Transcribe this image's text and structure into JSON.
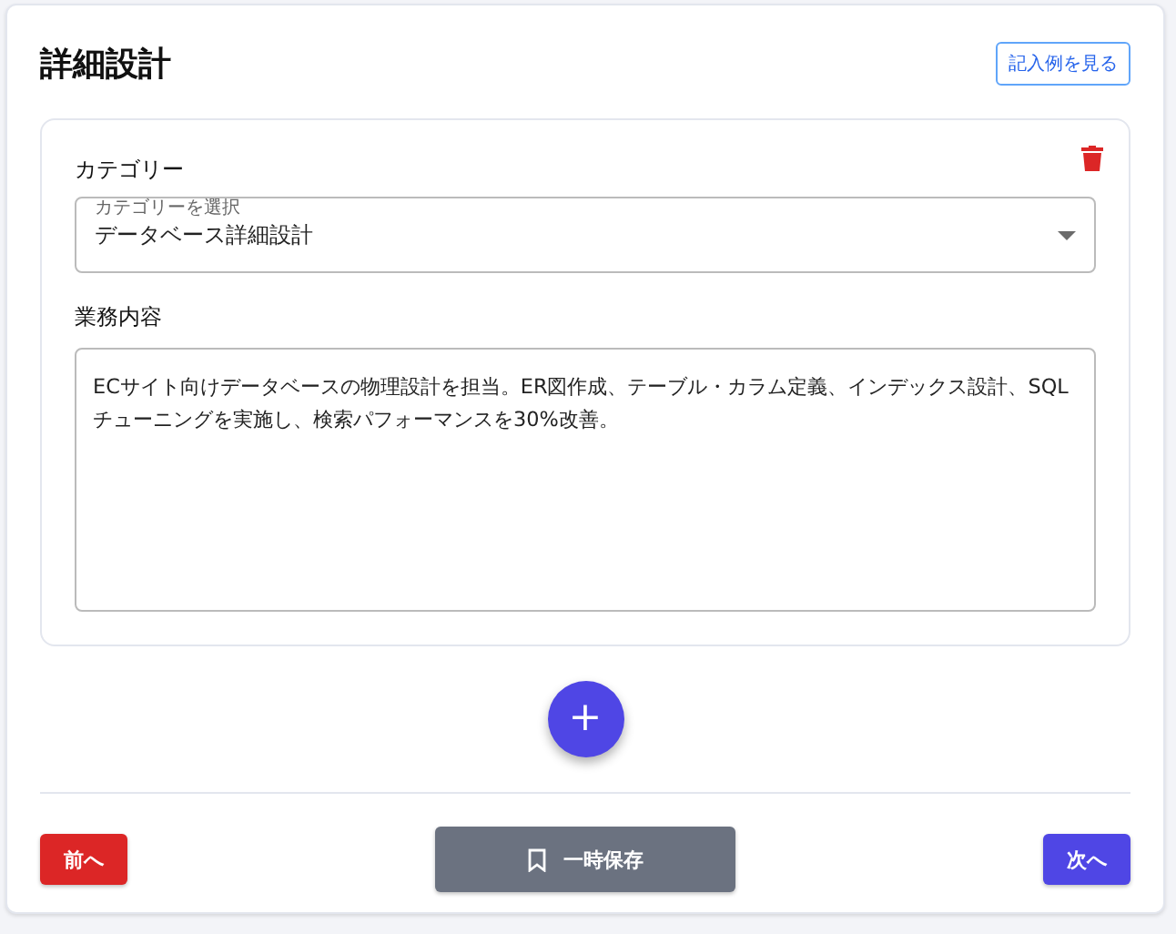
{
  "title": "詳細設計",
  "example_button": "記入例を見る",
  "entry": {
    "category_label": "カテゴリー",
    "select": {
      "label": "カテゴリーを選択",
      "value": "データベース詳細設計"
    },
    "content_label": "業務内容",
    "content": "ECサイト向けデータベースの物理設計を担当。ER図作成、テーブル・カラム定義、インデックス設計、SQLチューニングを実施し、検索パフォーマンスを30%改善。"
  },
  "add_button": "+",
  "footer": {
    "back": "前へ",
    "save": "一時保存",
    "next": "次へ"
  }
}
